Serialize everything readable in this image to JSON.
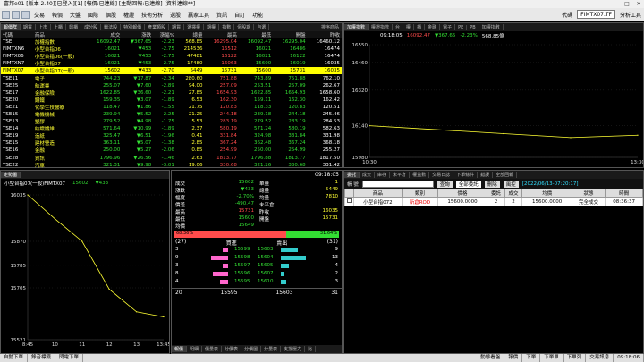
{
  "window": {
    "title": "富邦e01 [版本 2.40][已登入][1] [報價:已連線] [主動回報:已連線] [資料連線**]"
  },
  "menu": [
    "交易",
    "報價",
    "大盤",
    "國際",
    "個股",
    "權證",
    "技術分析",
    "選股",
    "贏家工具",
    "資訊",
    "自訂",
    "功能"
  ],
  "menu_right": {
    "symbol_label": "代碼",
    "symbol_value": "FIMTX07.TF",
    "analysis": "分析工具"
  },
  "quote_panel": {
    "tabs": [
      "報價群",
      "期貨",
      "上市",
      "上櫃",
      "興櫃",
      "成分股",
      "戰法股",
      "特別報價",
      "產業類股",
      "期貨",
      "選擇權",
      "期權",
      "指數",
      "個股期",
      "自選"
    ],
    "right_label": "排序商品",
    "columns": [
      "代碼",
      "商品",
      "成交",
      "漲跌",
      "漲幅%",
      "總量",
      "最高",
      "最低",
      "開盤",
      "昨收"
    ],
    "rows": [
      [
        "TSE",
        "加權指數",
        "16092.47",
        "▼367.65",
        "-2.23",
        "568.85",
        "16295.04",
        "16092.47",
        "16295.04",
        "16460.12"
      ],
      [
        "FIMTXN6",
        "小型台指06",
        "16021",
        "▼453",
        "-2.75",
        "214536",
        "16512",
        "16021",
        "16486",
        "16474"
      ],
      [
        "FIMTX06",
        "小型台指06(一般)",
        "16021",
        "▼453",
        "-2.75",
        "47481",
        "16122",
        "16021",
        "16122",
        "16474"
      ],
      [
        "FIMTXN7",
        "小型台指07",
        "16021",
        "▼453",
        "-2.75",
        "17480",
        "16063",
        "15600",
        "16019",
        "16035"
      ],
      [
        "FIMTX07",
        "小型台指07(一般)",
        "15602",
        "▼433",
        "-2.70",
        "5449",
        "15731",
        "15600",
        "15731",
        "16035"
      ],
      [
        "TSE11",
        "電子",
        "744.23",
        "▼17.87",
        "-2.34",
        "280.60",
        "751.88",
        "743.89",
        "751.88",
        "762.10"
      ],
      [
        "TSE25",
        "航運業",
        "255.07",
        "▼7.60",
        "-2.89",
        "94.00",
        "257.09",
        "253.51",
        "257.09",
        "262.67"
      ],
      [
        "TSE17",
        "金融保險",
        "1622.85",
        "▼36.60",
        "-2.21",
        "27.85",
        "1654.93",
        "1622.85",
        "1654.93",
        "1658.60"
      ],
      [
        "TSE20",
        "鋼鐵",
        "159.35",
        "▼3.07",
        "-1.89",
        "6.53",
        "162.30",
        "159.11",
        "162.30",
        "162.42"
      ],
      [
        "TSE21",
        "化學生技醫療",
        "118.47",
        "▼1.86",
        "-1.55",
        "21.75",
        "120.83",
        "118.33",
        "120.83",
        "120.51"
      ],
      [
        "TSE15",
        "電機機械",
        "239.94",
        "▼5.52",
        "-2.25",
        "21.25",
        "244.18",
        "239.18",
        "244.18",
        "245.46"
      ],
      [
        "TSE13",
        "塑膠",
        "279.52",
        "▼4.98",
        "-1.75",
        "5.53",
        "283.19",
        "279.52",
        "283.19",
        "284.53"
      ],
      [
        "TSE14",
        "紡織纖維",
        "571.64",
        "▼10.99",
        "-1.89",
        "2.37",
        "580.19",
        "571.24",
        "580.19",
        "582.63"
      ],
      [
        "TSE19",
        "造紙",
        "325.47",
        "▼6.51",
        "-1.96",
        "0.41",
        "331.84",
        "324.98",
        "331.84",
        "331.98"
      ],
      [
        "TSE15",
        "建材營造",
        "363.11",
        "▼5.07",
        "-1.38",
        "2.85",
        "367.24",
        "362.48",
        "367.24",
        "368.18"
      ],
      [
        "TSE16",
        "金融",
        "250.00",
        "▼5.27",
        "-2.06",
        "0.85",
        "254.99",
        "250.00",
        "254.99",
        "255.27"
      ],
      [
        "TSE28",
        "資訊",
        "1796.96",
        "▼26.56",
        "-1.46",
        "2.63",
        "1813.77",
        "1796.88",
        "1813.77",
        "1817.50"
      ],
      [
        "TSE22",
        "汽車",
        "321.31",
        "▼9.98",
        "-3.01",
        "19.06",
        "330.68",
        "321.26",
        "330.68",
        "331.42"
      ]
    ]
  },
  "index_chart": {
    "tabs": [
      "加權指數",
      "權證指數",
      "台",
      "權",
      "櫃",
      "金融",
      "電子",
      "PE",
      "PB",
      "加權指數"
    ],
    "time": "09:18:05",
    "value": "16092.47",
    "change": "▼367.65",
    "pct": "-2.23%",
    "volume": "568.85億",
    "y_labels": [
      "16550",
      "16460",
      "16320",
      "16140",
      "15980"
    ],
    "x_labels": [
      "10:30",
      "13:30"
    ]
  },
  "chart_data": [
    {
      "type": "line",
      "title": "小型台指07(一般)FIMTX07",
      "x_ticks": [
        "8:45",
        "10",
        "11",
        "12",
        "13",
        "13:45"
      ],
      "ylim": [
        15521,
        16035
      ],
      "y_ticks": [
        16035,
        15870,
        15785,
        15705,
        15521
      ],
      "series": [
        {
          "x": [
            0,
            2,
            4,
            6,
            8,
            10
          ],
          "values": [
            16035,
            15950,
            15870,
            15700,
            15620,
            15602
          ]
        }
      ]
    },
    {
      "type": "line",
      "title": "加權指數",
      "x_ticks": [
        "10:30",
        "13:30"
      ],
      "ylim": [
        15980,
        16550
      ],
      "y_ticks": [
        16550,
        16460,
        16320,
        16140,
        15980
      ],
      "series": [
        {
          "x": [
            0,
            2,
            4,
            6,
            8
          ],
          "values": [
            16140,
            16120,
            16100,
            16080,
            16092
          ]
        }
      ]
    }
  ],
  "detail": {
    "header_name": "小型台指07(一般)FIMTX07",
    "header_price": "15602",
    "header_change": "▼433",
    "time": "09:18:05",
    "left_rows": [
      [
        "成交",
        "15602"
      ],
      [
        "漲跌",
        "▼433"
      ],
      [
        "幅度",
        "-2.70%"
      ],
      [
        "價差",
        "-490.47"
      ],
      [
        "最高",
        "15731"
      ],
      [
        "最低",
        "15600"
      ],
      [
        "均價",
        "15649"
      ]
    ],
    "right_rows": [
      [
        "單量",
        "1"
      ],
      [
        "總量",
        "5449"
      ],
      [
        "均量",
        "7810"
      ],
      [
        "未平倉",
        ""
      ],
      [
        "昨收",
        "16035"
      ],
      [
        "開盤",
        "15731"
      ]
    ],
    "ratio_left": "68.36%",
    "ratio_right": "31.64%",
    "book": {
      "left_total": "(27)",
      "right_total": "(31)",
      "header": [
        "買進",
        "賣出"
      ],
      "rows": [
        [
          "3",
          "15599",
          "15603",
          "9"
        ],
        [
          "9",
          "15598",
          "15604",
          "13"
        ],
        [
          "3",
          "15597",
          "15605",
          "4"
        ],
        [
          "8",
          "15596",
          "15607",
          "2"
        ],
        [
          "4",
          "15595",
          "15610",
          "3"
        ]
      ],
      "sum": [
        "20",
        "15595",
        "15603",
        "31"
      ]
    },
    "bottom_tabs": [
      "報價",
      "明細",
      "價量表",
      "分價表",
      "分價圖",
      "分量表",
      "支撐壓力",
      "比"
    ]
  },
  "orders": {
    "tabs": [
      "委託",
      "成交",
      "庫存",
      "未平倉",
      "權益數",
      "交易日誌",
      "下單條件",
      "錯誤",
      "全部回報"
    ],
    "account_label": "帳 號",
    "query": "查詢",
    "filter": "全部委託",
    "delete": "刪除",
    "risk": "風控",
    "date": "[2022/06/13-07:20:17]",
    "columns": [
      "",
      "商品",
      "類別",
      "價格",
      "委託",
      "成交",
      "均價",
      "狀態",
      "時間"
    ],
    "rows": [
      [
        "",
        "小型台指072",
        "新倉ROD",
        "15600.0000",
        "2",
        "2",
        "15600.0000",
        "完全成交",
        "08:36:37"
      ]
    ]
  },
  "status": {
    "items": [
      "自動下單",
      "錄音標籤",
      "閃電下單"
    ],
    "right": [
      "動態看盤",
      "報價",
      "下單",
      "下單單",
      "下單列",
      "交易訊息"
    ],
    "clock": "09:18:06"
  },
  "colors": {
    "up": "#ff4b4b",
    "down": "#33dd33",
    "highlight": "#ffff00",
    "bid": "#ff66cc",
    "ask": "#33cccc"
  }
}
